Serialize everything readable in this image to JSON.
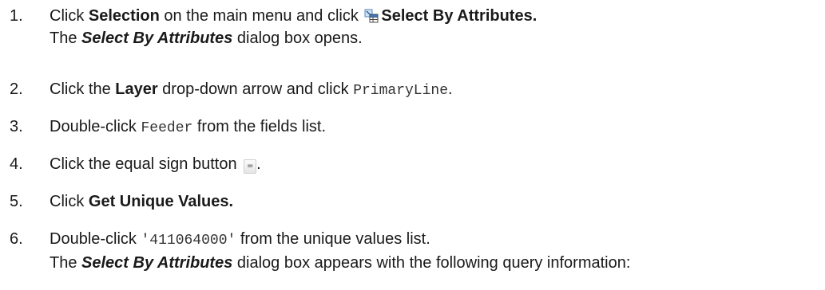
{
  "steps": [
    {
      "number": "1.",
      "pre": "Click ",
      "bold1": "Selection",
      "mid": " on the main menu and click ",
      "icon": "select-by-attributes-icon",
      "bold2": "Select By Attributes.",
      "line2_pre": "The ",
      "line2_bi": "Select By Attributes",
      "line2_post": " dialog box opens."
    },
    {
      "number": "2.",
      "pre": "Click the ",
      "bold": "Layer",
      "mid": " drop-down arrow and click ",
      "code": "PrimaryLine",
      "post": "."
    },
    {
      "number": "3.",
      "pre": "Double-click ",
      "code": "Feeder",
      "post": " from the fields list."
    },
    {
      "number": "4.",
      "pre": "Click the equal sign button ",
      "button_label": "=",
      "post": "."
    },
    {
      "number": "5.",
      "pre": "Click ",
      "bold": "Get Unique Values."
    },
    {
      "number": "6.",
      "pre": "Double-click ",
      "code": "'411064000'",
      "post": " from the unique values list.",
      "line2_pre": "The ",
      "line2_bi": "Select By Attributes",
      "line2_post": " dialog box appears with the following query information:"
    }
  ]
}
